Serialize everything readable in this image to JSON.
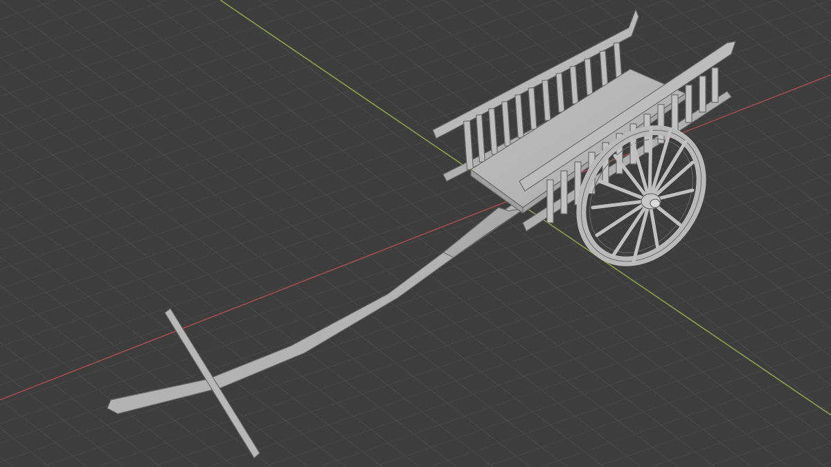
{
  "viewport": {
    "view": "3D Viewport",
    "shading": "solid",
    "object": "cart",
    "colors": {
      "background": "#3d3d3d",
      "grid": "#4a4a4a",
      "x_axis": "#a04b50",
      "y_axis": "#8ba04a",
      "model": "#b7b7b7"
    }
  }
}
